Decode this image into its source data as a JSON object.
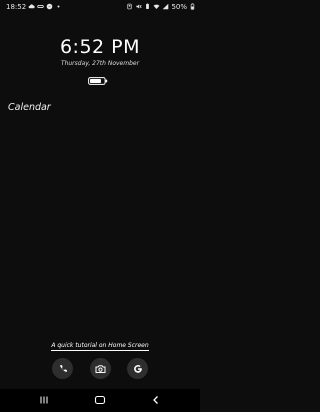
{
  "status_bar": {
    "time": "18:52",
    "battery_percent": "50%",
    "left_icons": [
      "cloud-icon",
      "link-icon",
      "messenger-icon",
      "dot-icon"
    ],
    "right_icons": [
      "alarm-icon",
      "mute-icon",
      "battery-saver-icon",
      "wifi-icon",
      "signal-icon",
      "battery-icon"
    ]
  },
  "lock_screen": {
    "clock": "6:52 PM",
    "date": "Thursday, 27th November",
    "battery_level_fraction": 0.8
  },
  "widget": {
    "calendar_label": "Calendar"
  },
  "tutorial": {
    "link_text": "A quick tutorial on Home Screen"
  },
  "dock": {
    "items": [
      "phone-icon",
      "camera-icon",
      "google-icon"
    ]
  },
  "nav_bar": {
    "buttons": [
      "recents-button",
      "home-button",
      "back-button"
    ]
  }
}
